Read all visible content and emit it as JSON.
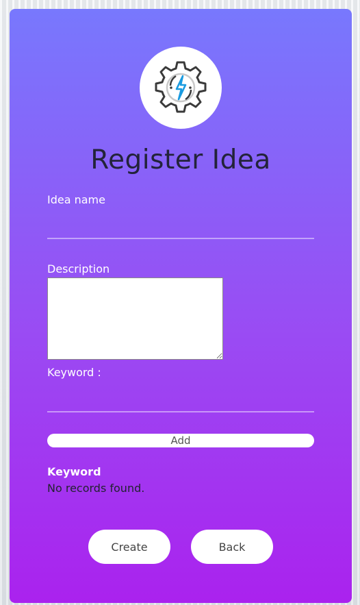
{
  "form": {
    "title": "Register Idea",
    "idea_name_label": "Idea name",
    "idea_name_value": "",
    "description_label": "Description",
    "description_value": "",
    "keyword_label": "Keyword :",
    "keyword_value": "",
    "add_label": "Add"
  },
  "keyword_table": {
    "header": "Keyword",
    "empty_text": "No records found."
  },
  "actions": {
    "create_label": "Create",
    "back_label": "Back"
  },
  "icons": {
    "logo": "gear-lightning-icon"
  },
  "colors": {
    "gradient_top": "#7878fd",
    "gradient_bottom": "#aa22ee",
    "gear_stroke": "#3a3a3a",
    "bolt": "#1a9be0"
  }
}
